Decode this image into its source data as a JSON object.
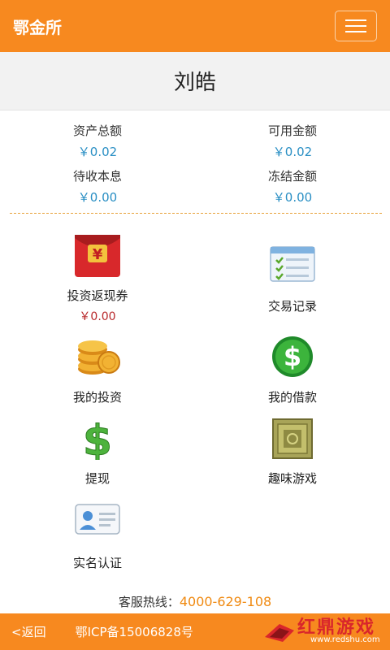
{
  "header": {
    "brand": "鄂金所",
    "menu_icon": "hamburger-menu-icon"
  },
  "user": {
    "name": "刘皓"
  },
  "stats": [
    {
      "label": "资产总额",
      "value": "￥0.02"
    },
    {
      "label": "可用金额",
      "value": "￥0.02"
    },
    {
      "label": "待收本息",
      "value": "￥0.00"
    },
    {
      "label": "冻结金额",
      "value": "￥0.00"
    }
  ],
  "tiles": [
    {
      "label": "投资返现券",
      "sub": "￥0.00",
      "icon": "red-envelope-icon"
    },
    {
      "label": "交易记录",
      "icon": "transaction-list-icon"
    },
    {
      "label": "我的投资",
      "icon": "coin-stack-icon"
    },
    {
      "label": "我的借款",
      "icon": "dollar-circle-icon"
    },
    {
      "label": "提现",
      "icon": "dollar-sign-icon"
    },
    {
      "label": "趣味游戏",
      "icon": "wooden-crate-icon"
    },
    {
      "label": "实名认证",
      "icon": "id-card-icon"
    }
  ],
  "footer": {
    "hotline_label": "客服热线：",
    "hotline_number": "4000-629-108",
    "back": "<返回",
    "icp": "鄂ICP备15006828号"
  },
  "watermark": {
    "title": "红鼎游戏",
    "url": "www.redshu.com"
  },
  "colors": {
    "brand": "#f7891f",
    "value_blue": "#2a8fc4",
    "coupon_red": "#b8282a",
    "hotline_orange": "#f08a12"
  }
}
